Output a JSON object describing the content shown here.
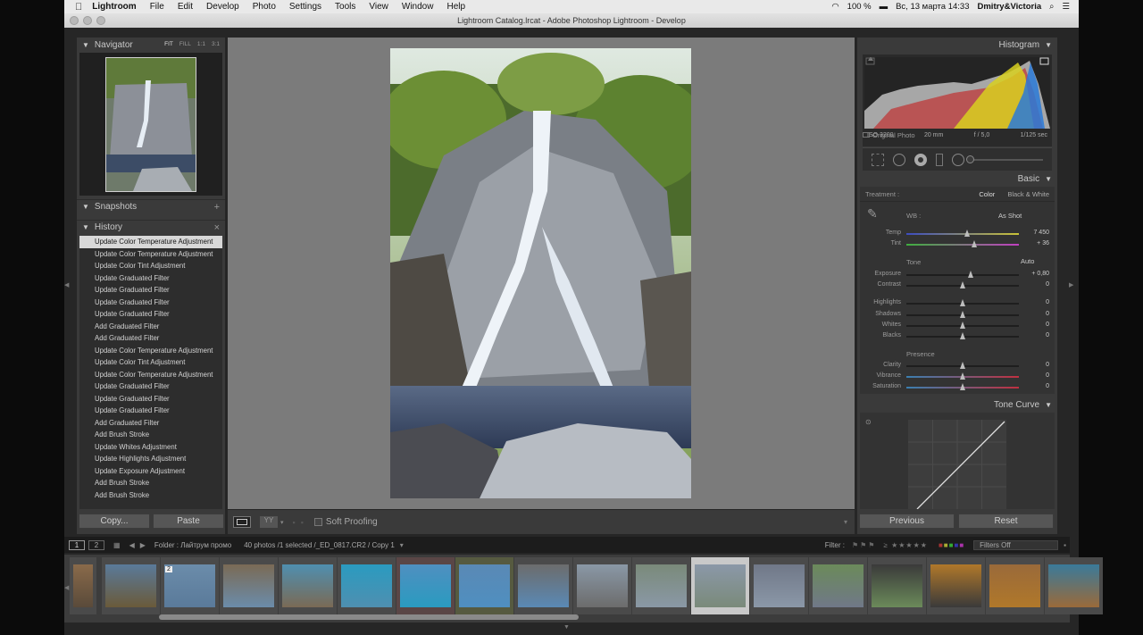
{
  "menubar": {
    "apple": "",
    "app": "Lightroom",
    "items": [
      "File",
      "Edit",
      "Develop",
      "Photo",
      "Settings",
      "Tools",
      "View",
      "Window",
      "Help"
    ],
    "battery": "100 %",
    "datetime": "Вс, 13 марта  14:33",
    "user": "Dmitry&Victoria"
  },
  "window": {
    "title": "Lightroom Catalog.lrcat - Adobe Photoshop Lightroom - Develop"
  },
  "navigator": {
    "title": "Navigator",
    "zoom": [
      "FIT",
      "FILL",
      "1:1",
      "3:1"
    ]
  },
  "snapshots": {
    "title": "Snapshots",
    "add": "+"
  },
  "history": {
    "title": "History",
    "close": "×",
    "items": [
      "Update Color Temperature Adjustment",
      "Update Color Temperature Adjustment",
      "Update Color Tint Adjustment",
      "Update Graduated Filter",
      "Update Graduated Filter",
      "Update Graduated Filter",
      "Update Graduated Filter",
      "Add Graduated Filter",
      "Add Graduated Filter",
      "Update Color Temperature Adjustment",
      "Update Color Tint Adjustment",
      "Update Color Temperature Adjustment",
      "Update Graduated Filter",
      "Update Graduated Filter",
      "Update Graduated Filter",
      "Add Graduated Filter",
      "Add Brush Stroke",
      "Update Whites Adjustment",
      "Update Highlights Adjustment",
      "Update Exposure Adjustment",
      "Add Brush Stroke",
      "Add Brush Stroke"
    ]
  },
  "left_buttons": {
    "copy": "Copy...",
    "paste": "Paste"
  },
  "toolbar": {
    "soft_proofing": "Soft Proofing"
  },
  "histogram": {
    "title": "Histogram",
    "iso": "ISO 3200",
    "focal": "20 mm",
    "aperture": "f / 5,0",
    "shutter": "1/125 sec",
    "original": "Original Photo"
  },
  "basic": {
    "title": "Basic",
    "treatment_label": "Treatment :",
    "color": "Color",
    "bw": "Black & White",
    "wb_label": "WB :",
    "wb_value": "As Shot",
    "tone": "Tone",
    "auto": "Auto",
    "presence": "Presence",
    "sliders": [
      {
        "name": "Temp",
        "value": "7 450",
        "pos": 0.54
      },
      {
        "name": "Tint",
        "value": "+ 36",
        "pos": 0.6
      },
      {
        "name": "Exposure",
        "value": "+ 0,80",
        "pos": 0.57
      },
      {
        "name": "Contrast",
        "value": "0",
        "pos": 0.5
      },
      {
        "name": "Highlights",
        "value": "0",
        "pos": 0.5
      },
      {
        "name": "Shadows",
        "value": "0",
        "pos": 0.5
      },
      {
        "name": "Whites",
        "value": "0",
        "pos": 0.5
      },
      {
        "name": "Blacks",
        "value": "0",
        "pos": 0.5
      },
      {
        "name": "Clarity",
        "value": "0",
        "pos": 0.5
      },
      {
        "name": "Vibrance",
        "value": "0",
        "pos": 0.5
      },
      {
        "name": "Saturation",
        "value": "0",
        "pos": 0.5
      }
    ]
  },
  "tone_curve": {
    "title": "Tone Curve"
  },
  "right_buttons": {
    "previous": "Previous",
    "reset": "Reset"
  },
  "filmstrip": {
    "view1": "1",
    "view2": "2",
    "folder": "Folder : Лайтрум промо",
    "count": "40 photos /1 selected /_ED_0817.CR2 / Copy 1",
    "filter_label": "Filter :",
    "filters_off": "Filters Off",
    "badge": "2"
  }
}
